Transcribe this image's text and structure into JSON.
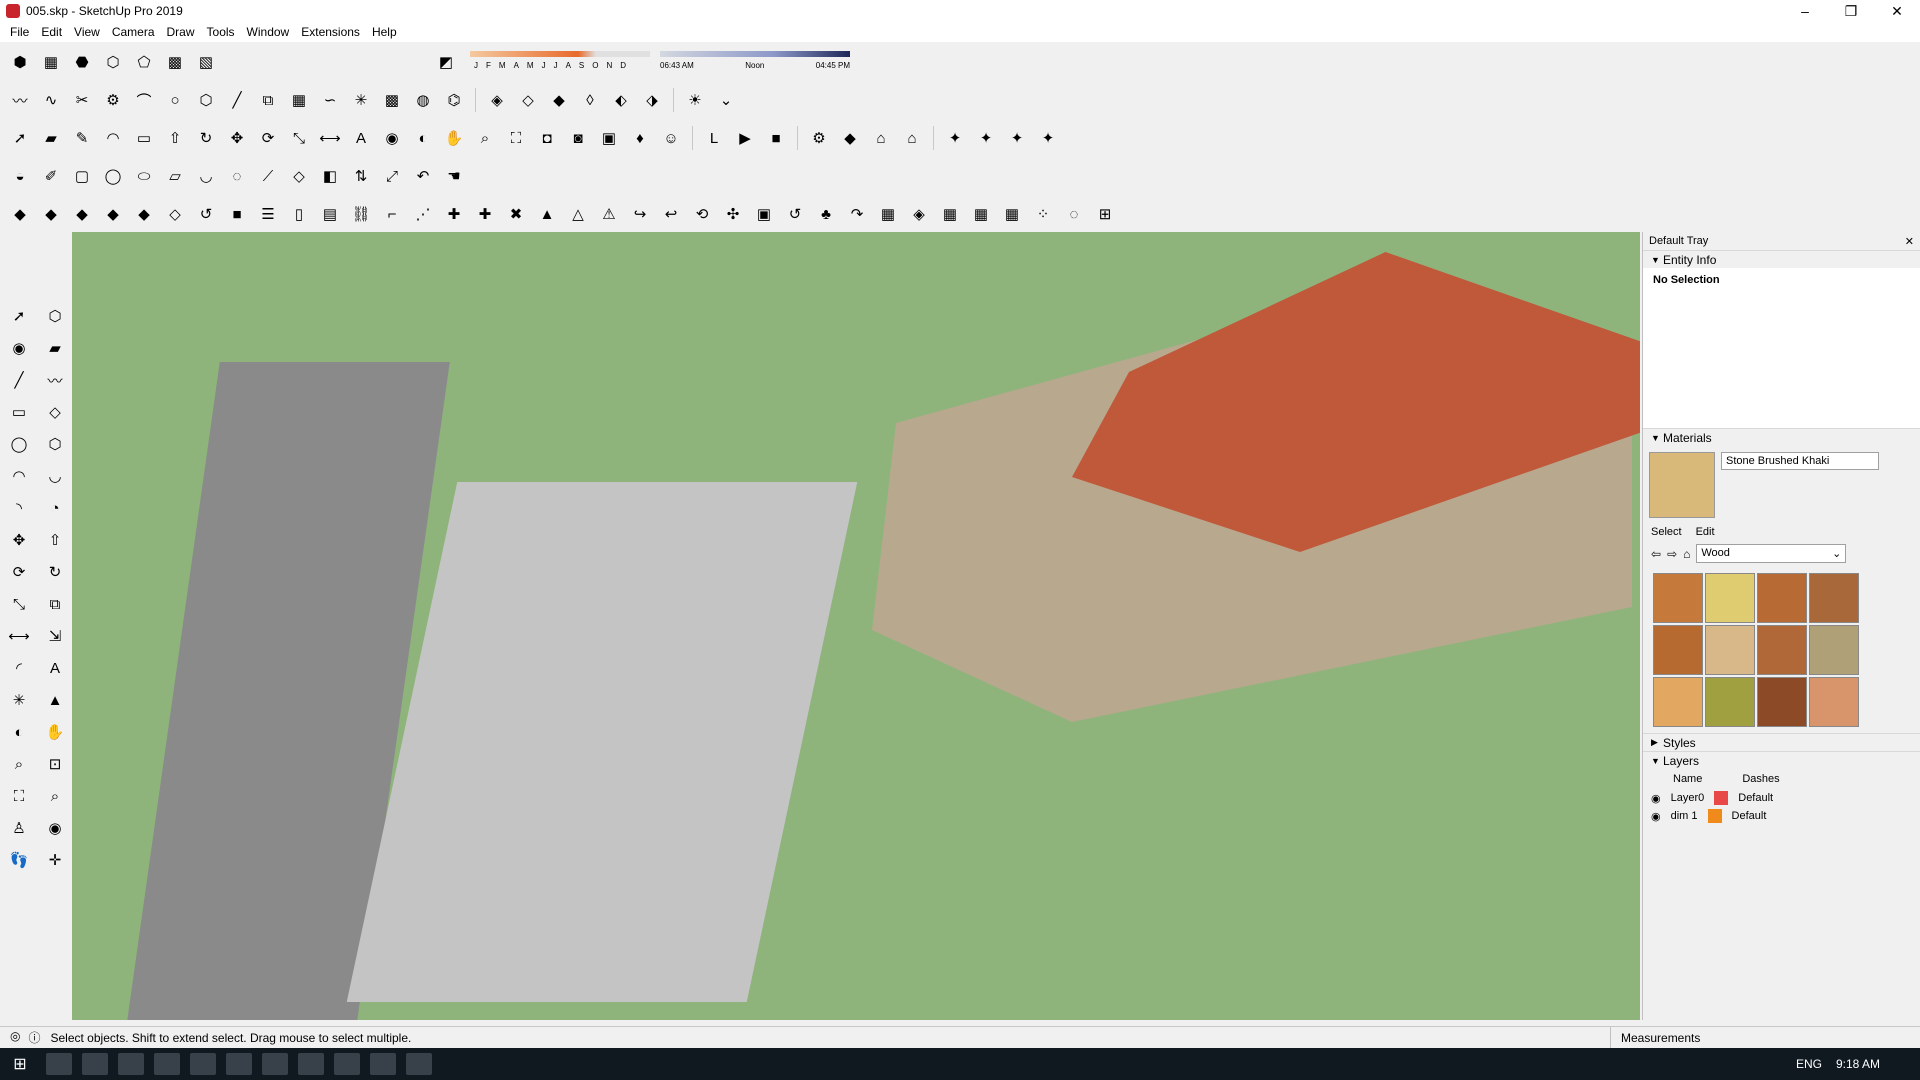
{
  "window": {
    "title": "005.skp - SketchUp Pro 2019",
    "minimize": "–",
    "maximize": "❐",
    "close": "✕"
  },
  "menu": [
    "File",
    "Edit",
    "View",
    "Camera",
    "Draw",
    "Tools",
    "Window",
    "Extensions",
    "Help"
  ],
  "shadows": {
    "months": [
      "J",
      "F",
      "M",
      "A",
      "M",
      "J",
      "J",
      "A",
      "S",
      "O",
      "N",
      "D"
    ],
    "time_start": "06:43 AM",
    "time_mid": "Noon",
    "time_end": "04:45 PM"
  },
  "tray": {
    "title": "Default Tray",
    "entity_info": {
      "label": "Entity Info",
      "value": "No Selection"
    },
    "materials": {
      "label": "Materials",
      "name": "Stone Brushed Khaki",
      "tab_select": "Select",
      "tab_edit": "Edit",
      "library": "Wood",
      "swatch_colors": [
        "#c57a3c",
        "#e0cc70",
        "#b86a34",
        "#a8683a",
        "#b66a30",
        "#d8b888",
        "#b06838",
        "#b0a078",
        "#e2a862",
        "#a0a040",
        "#8c4a26",
        "#d8946a"
      ]
    },
    "styles": {
      "label": "Styles"
    },
    "layers": {
      "label": "Layers",
      "col_name": "Name",
      "col_dashes": "Dashes",
      "rows": [
        {
          "name": "Layer0",
          "dashes": "Default",
          "color": "#e84848"
        },
        {
          "name": "dim 1",
          "dashes": "Default",
          "color": "#f08a1a"
        }
      ]
    }
  },
  "status": {
    "hint": "Select objects. Shift to extend select. Drag mouse to select multiple.",
    "measurements": "Measurements"
  },
  "taskbar": {
    "language": "ENG",
    "time": "9:18 AM"
  }
}
